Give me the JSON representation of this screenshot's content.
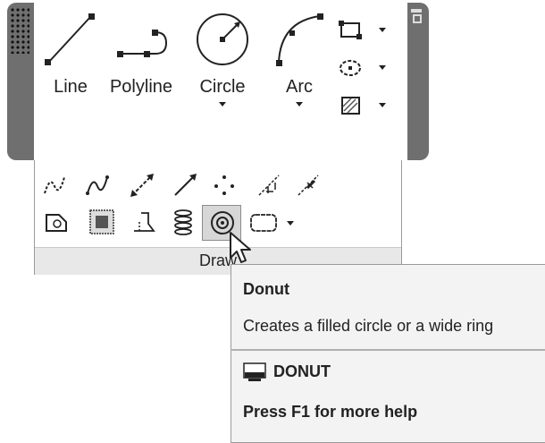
{
  "panel": {
    "title": "Draw",
    "main_buttons": [
      {
        "label": "Line",
        "icon": "line-icon"
      },
      {
        "label": "Polyline",
        "icon": "polyline-icon"
      },
      {
        "label": "Circle",
        "icon": "circle-icon",
        "has_dropdown": true
      },
      {
        "label": "Arc",
        "icon": "arc-icon",
        "has_dropdown": true
      }
    ],
    "side_buttons": [
      "rectangle-icon",
      "ellipse-icon",
      "hatch-icon"
    ],
    "expanded_row1": [
      "spline-fit-icon",
      "spline-cv-icon",
      "construction-line-icon",
      "ray-icon",
      "multiple-points-icon",
      "divide-icon",
      "measure-icon"
    ],
    "expanded_row2": [
      "region-icon",
      "wipeout-icon",
      "3d-polyline-icon",
      "helix-icon",
      "donut-icon",
      "revision-cloud-icon"
    ],
    "highlighted_tool": "donut-icon"
  },
  "tooltip": {
    "title": "Donut",
    "description": "Creates a filled circle or a wide ring",
    "command": "DONUT",
    "help": "Press F1 for more help"
  }
}
